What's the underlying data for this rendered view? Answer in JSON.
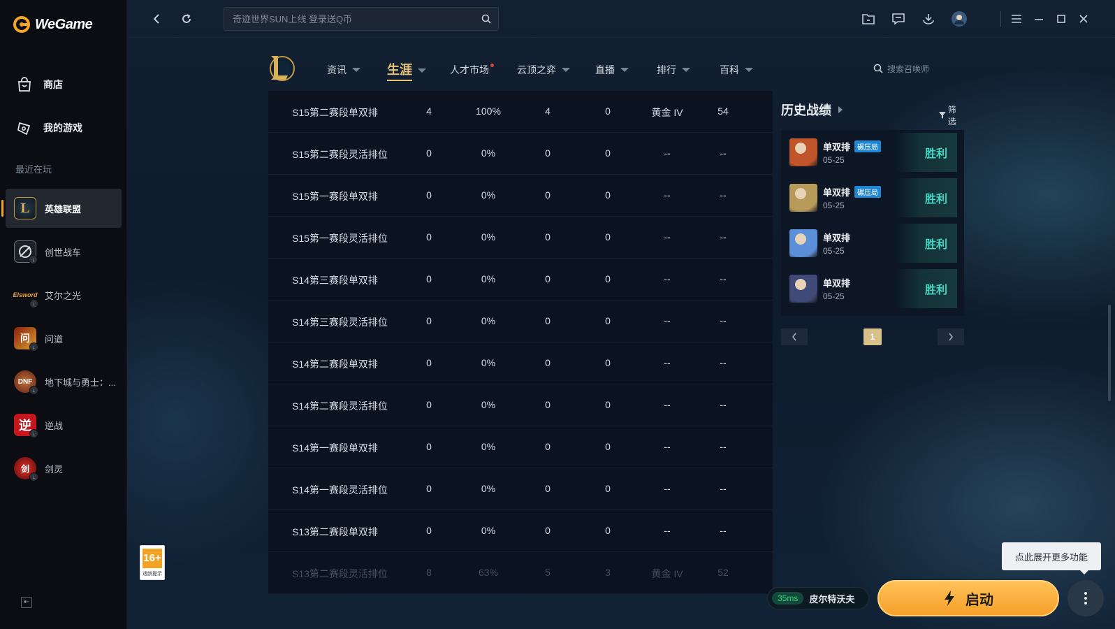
{
  "app": {
    "name": "WeGame"
  },
  "sidebar": {
    "nav": [
      {
        "label": "商店",
        "icon": "store-bag-icon"
      },
      {
        "label": "我的游戏",
        "icon": "gamepad-icon"
      }
    ],
    "recent_label": "最近在玩",
    "recent": [
      {
        "label": "英雄联盟",
        "icon": "lol-icon",
        "active": true
      },
      {
        "label": "创世战车",
        "icon": "crossout-icon"
      },
      {
        "label": "艾尔之光",
        "icon": "elsword-icon"
      },
      {
        "label": "问道",
        "icon": "wendao-icon"
      },
      {
        "label": "地下城与勇士：...",
        "icon": "dnf-icon"
      },
      {
        "label": "逆战",
        "icon": "nizhan-icon"
      },
      {
        "label": "剑灵",
        "icon": "bladesoul-icon"
      }
    ]
  },
  "topbar": {
    "search_placeholder": "奇迹世界SUN上线 登录送Q币"
  },
  "lolnav": {
    "tabs": [
      {
        "label": "资讯",
        "caret": true
      },
      {
        "label": "生涯",
        "caret": true,
        "active": true
      },
      {
        "label": "人才市场",
        "caret": false,
        "dot": true
      },
      {
        "label": "云顶之弈",
        "caret": true
      },
      {
        "label": "直播",
        "caret": true
      },
      {
        "label": "排行",
        "caret": true
      },
      {
        "label": "百科",
        "caret": true
      }
    ],
    "summoner_search_placeholder": "搜索召唤师"
  },
  "seasons": [
    [
      "S15第二赛段单双排",
      "4",
      "100%",
      "4",
      "0",
      "黄金 IV",
      "54"
    ],
    [
      "S15第二赛段灵活排位",
      "0",
      "0%",
      "0",
      "0",
      "--",
      "--"
    ],
    [
      "S15第一赛段单双排",
      "0",
      "0%",
      "0",
      "0",
      "--",
      "--"
    ],
    [
      "S15第一赛段灵活排位",
      "0",
      "0%",
      "0",
      "0",
      "--",
      "--"
    ],
    [
      "S14第三赛段单双排",
      "0",
      "0%",
      "0",
      "0",
      "--",
      "--"
    ],
    [
      "S14第三赛段灵活排位",
      "0",
      "0%",
      "0",
      "0",
      "--",
      "--"
    ],
    [
      "S14第二赛段单双排",
      "0",
      "0%",
      "0",
      "0",
      "--",
      "--"
    ],
    [
      "S14第二赛段灵活排位",
      "0",
      "0%",
      "0",
      "0",
      "--",
      "--"
    ],
    [
      "S14第一赛段单双排",
      "0",
      "0%",
      "0",
      "0",
      "--",
      "--"
    ],
    [
      "S14第一赛段灵活排位",
      "0",
      "0%",
      "0",
      "0",
      "--",
      "--"
    ],
    [
      "S13第二赛段单双排",
      "0",
      "0%",
      "0",
      "0",
      "--",
      "--"
    ],
    [
      "S13第二赛段灵活排位",
      "8",
      "63%",
      "5",
      "3",
      "黄金 IV",
      "52"
    ]
  ],
  "history": {
    "title": "历史战绩",
    "filter_label": "筛选",
    "matches": [
      {
        "mode": "单双排",
        "tag": "碾压局",
        "date": "05-25",
        "result": "胜利",
        "avatar_color": "#c0542a"
      },
      {
        "mode": "单双排",
        "tag": "碾压局",
        "date": "05-25",
        "result": "胜利",
        "avatar_color": "#b89a5a"
      },
      {
        "mode": "单双排",
        "tag": "",
        "date": "05-25",
        "result": "胜利",
        "avatar_color": "#5b8fd8"
      },
      {
        "mode": "单双排",
        "tag": "",
        "date": "05-25",
        "result": "胜利",
        "avatar_color": "#404a78"
      }
    ],
    "page": "1"
  },
  "bottom": {
    "age_rating": "16+",
    "age_note": "适龄提示",
    "tooltip": "点此展开更多功能",
    "ping": "35ms",
    "server": "皮尔特沃夫",
    "launch_label": "启动"
  }
}
